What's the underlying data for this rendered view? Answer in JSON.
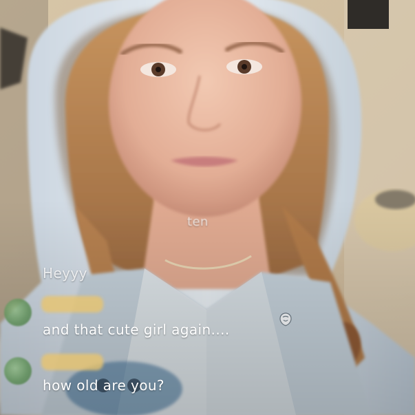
{
  "comments": [
    {
      "text": "ten"
    },
    {
      "text": "Heyyy"
    },
    {
      "text": "and that cute girl again...."
    },
    {
      "text": "how old are you?"
    }
  ],
  "colors": {
    "text": "#ffffff",
    "avatar": "#6a9a62",
    "name_pill": "#e8c46e"
  }
}
